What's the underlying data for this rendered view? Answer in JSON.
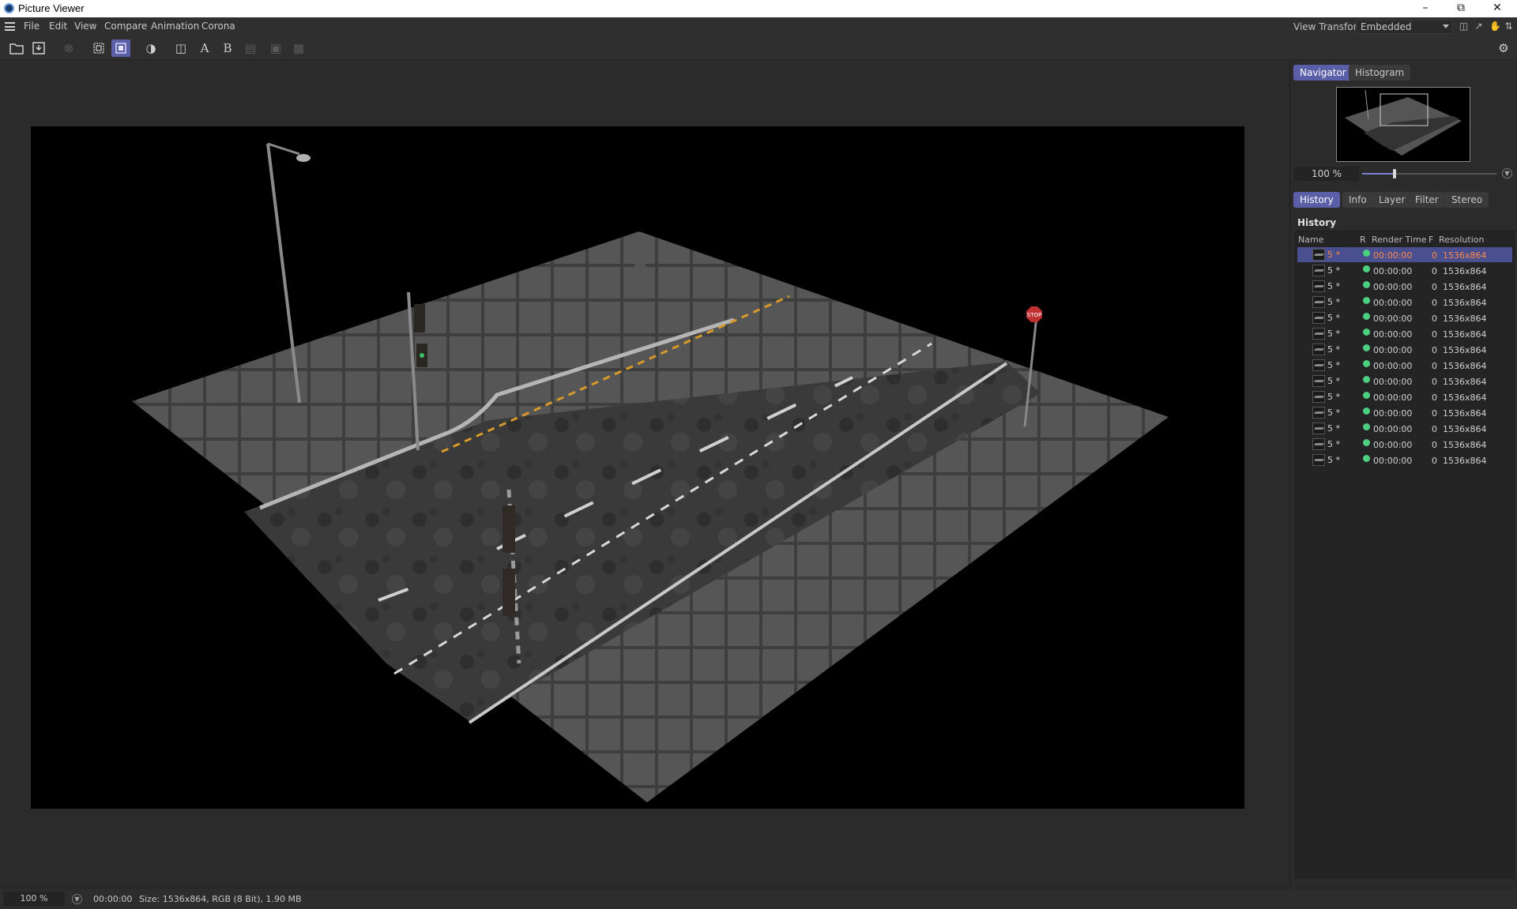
{
  "window": {
    "title": "Picture Viewer"
  },
  "menu": {
    "items": [
      "File",
      "Edit",
      "View",
      "Compare",
      "Animation",
      "Corona"
    ]
  },
  "view_transform": {
    "label": "View Transform",
    "value": "Embedded"
  },
  "navigator": {
    "tabs": [
      "Navigator",
      "Histogram"
    ],
    "zoom_value": "100 %",
    "zoom_slider_fraction": 0.24
  },
  "panel_tabs": [
    "History",
    "Info",
    "Layer",
    "Filter",
    "Stereo"
  ],
  "history": {
    "title": "History",
    "columns": {
      "name": "Name",
      "r": "R",
      "render_time": "Render Time",
      "f": "F",
      "resolution": "Resolution"
    },
    "rows": [
      {
        "name": "5 *",
        "render_time": "00:00:00",
        "f": "0",
        "resolution": "1536x864",
        "selected": true
      },
      {
        "name": "5 *",
        "render_time": "00:00:00",
        "f": "0",
        "resolution": "1536x864"
      },
      {
        "name": "5 *",
        "render_time": "00:00:00",
        "f": "0",
        "resolution": "1536x864"
      },
      {
        "name": "5 *",
        "render_time": "00:00:00",
        "f": "0",
        "resolution": "1536x864"
      },
      {
        "name": "5 *",
        "render_time": "00:00:00",
        "f": "0",
        "resolution": "1536x864"
      },
      {
        "name": "5 *",
        "render_time": "00:00:00",
        "f": "0",
        "resolution": "1536x864"
      },
      {
        "name": "5 *",
        "render_time": "00:00:00",
        "f": "0",
        "resolution": "1536x864"
      },
      {
        "name": "5 *",
        "render_time": "00:00:00",
        "f": "0",
        "resolution": "1536x864"
      },
      {
        "name": "5 *",
        "render_time": "00:00:00",
        "f": "0",
        "resolution": "1536x864"
      },
      {
        "name": "5 *",
        "render_time": "00:00:00",
        "f": "0",
        "resolution": "1536x864"
      },
      {
        "name": "5 *",
        "render_time": "00:00:00",
        "f": "0",
        "resolution": "1536x864"
      },
      {
        "name": "5 *",
        "render_time": "00:00:00",
        "f": "0",
        "resolution": "1536x864"
      },
      {
        "name": "5 *",
        "render_time": "00:00:00",
        "f": "0",
        "resolution": "1536x864"
      },
      {
        "name": "5 *",
        "render_time": "00:00:00",
        "f": "0",
        "resolution": "1536x864"
      }
    ]
  },
  "toolbar": {
    "compare_a": "A",
    "compare_b": "B"
  },
  "scene": {
    "stop_sign_text": "STOP"
  },
  "status": {
    "zoom": "100 %",
    "time": "00:00:00",
    "size": "Size: 1536x864, RGB (8 Bit), 1.90 MB"
  },
  "colors": {
    "accent": "#5a5fa8",
    "selected_text": "#ff8a4a",
    "status_dot": "#4cd080"
  }
}
